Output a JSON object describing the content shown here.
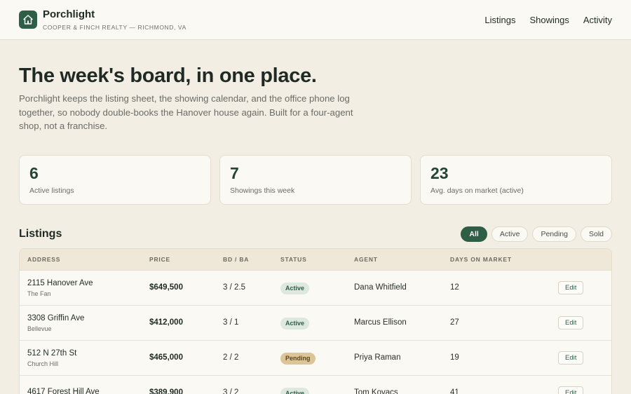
{
  "brand": {
    "name": "Porchlight",
    "subtitle": "COOPER & FINCH REALTY — RICHMOND, VA"
  },
  "nav": {
    "items": [
      {
        "label": "Listings"
      },
      {
        "label": "Showings"
      },
      {
        "label": "Activity"
      }
    ]
  },
  "hero": {
    "title": "The week's board, in one place.",
    "body": "Porchlight keeps the listing sheet, the showing calendar, and the office phone log together, so nobody double-books the Hanover house again. Built for a four-agent shop, not a franchise."
  },
  "stats": [
    {
      "value": "6",
      "label": "Active listings"
    },
    {
      "value": "7",
      "label": "Showings this week"
    },
    {
      "value": "23",
      "label": "Avg. days on market (active)"
    }
  ],
  "listings": {
    "title": "Listings",
    "filters": [
      {
        "label": "All",
        "selected": true
      },
      {
        "label": "Active",
        "selected": false
      },
      {
        "label": "Pending",
        "selected": false
      },
      {
        "label": "Sold",
        "selected": false
      }
    ],
    "columns": [
      "ADDRESS",
      "PRICE",
      "BD / BA",
      "STATUS",
      "AGENT",
      "DAYS ON MARKET"
    ],
    "rows": [
      {
        "address": "2115 Hanover Ave",
        "neighborhood": "The Fan",
        "price": "$649,500",
        "bdba": "3 / 2.5",
        "status": "Active",
        "agent": "Dana Whitfield",
        "dom": "12",
        "edit": "Edit"
      },
      {
        "address": "3308 Griffin Ave",
        "neighborhood": "Bellevue",
        "price": "$412,000",
        "bdba": "3 / 1",
        "status": "Active",
        "agent": "Marcus Ellison",
        "dom": "27",
        "edit": "Edit"
      },
      {
        "address": "512 N 27th St",
        "neighborhood": "Church Hill",
        "price": "$465,000",
        "bdba": "2 / 2",
        "status": "Pending",
        "agent": "Priya Raman",
        "dom": "19",
        "edit": "Edit"
      },
      {
        "address": "4617 Forest Hill Ave",
        "neighborhood": "",
        "price": "$389,900",
        "bdba": "3 / 2",
        "status": "Active",
        "agent": "Tom Kovacs",
        "dom": "41",
        "edit": "Edit"
      }
    ]
  },
  "colors": {
    "accent": "#2f5e47",
    "background": "#f3eee4",
    "badge_active": "#dde8df",
    "badge_pending": "#dcc597"
  }
}
